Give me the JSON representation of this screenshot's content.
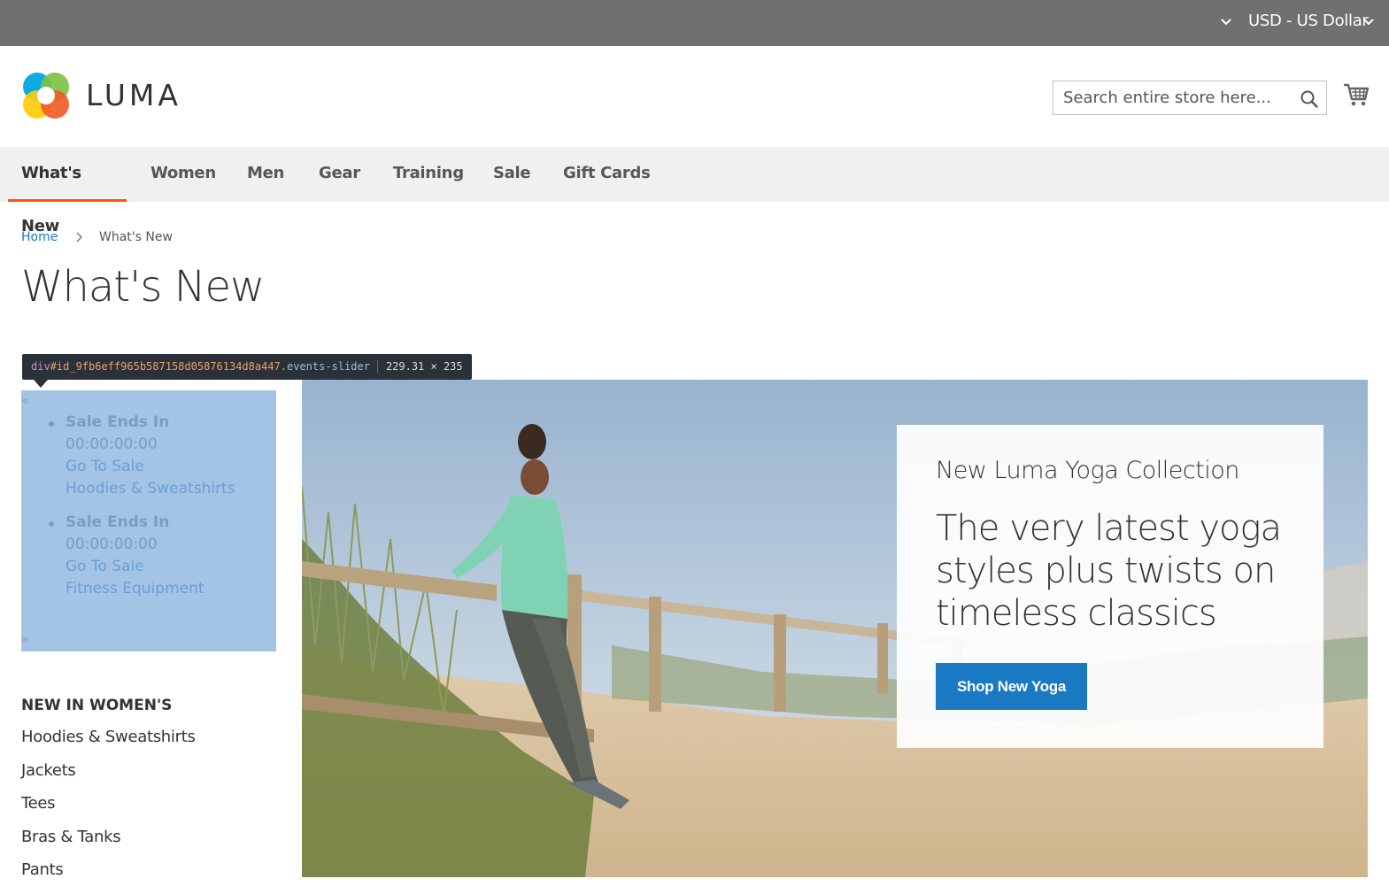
{
  "topbar": {
    "currency": "USD - US Dollar"
  },
  "header": {
    "logo_text": "LUMA",
    "search_placeholder": "Search entire store here..."
  },
  "nav": {
    "items": [
      "What's New",
      "Women",
      "Men",
      "Gear",
      "Training",
      "Sale",
      "Gift Cards"
    ],
    "active": "What's New"
  },
  "breadcrumb": {
    "home": "Home",
    "current": "What's New"
  },
  "page_title": "What's New",
  "devtools_tooltip": {
    "tag": "div",
    "id": "#id_9fb6eff965b587158d05876134d8a447",
    "class": ".events-slider",
    "dimensions": "229.31 × 235"
  },
  "events_slider": {
    "prev": "«",
    "next": "»",
    "events": [
      {
        "title": "Sale Ends In",
        "countdown": "00:00:00:00",
        "link": "Go To Sale",
        "category": "Hoodies & Sweatshirts"
      },
      {
        "title": "Sale Ends In",
        "countdown": "00:00:00:00",
        "link": "Go To Sale",
        "category": "Fitness Equipment"
      }
    ]
  },
  "sidebar": {
    "heading": "NEW IN WOMEN'S",
    "links": [
      "Hoodies & Sweatshirts",
      "Jackets",
      "Tees",
      "Bras & Tanks",
      "Pants"
    ]
  },
  "hero": {
    "subtitle": "New Luma Yoga Collection",
    "headline": "The very latest yoga styles plus twists on timeless classics",
    "button": "Shop New Yoga"
  },
  "colors": {
    "topbar": "#6e716e",
    "accent_underline": "#ff5501",
    "link": "#1979c3",
    "slider_highlight": "#a4c4e6",
    "button": "#1979c3"
  }
}
